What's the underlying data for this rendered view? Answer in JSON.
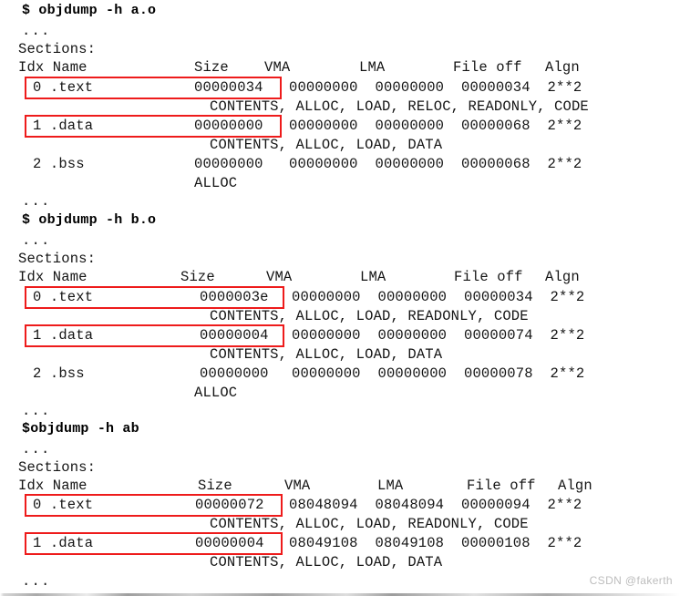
{
  "document": {
    "kind": "terminal-transcript",
    "watermark": "CSDN @fakerth",
    "colors": {
      "background": "#ffffff",
      "text": "#141414",
      "highlight": "#ee1b1b",
      "watermark": "#bdbdbd"
    }
  },
  "blocks": [
    {
      "id": "a-o",
      "command": "$ objdump -h a.o",
      "pre_ellipsis": "...",
      "sections_label": "Sections:",
      "header": "Idx Name          Size      VMA       LMA       File off  Algn",
      "header_cols": [
        "Idx",
        "Name",
        "Size",
        "VMA",
        "LMA",
        "File off",
        "Algn"
      ],
      "rows": [
        {
          "idx": "0",
          "name": ".text",
          "size": "00000034",
          "vma": "00000000",
          "lma": "00000000",
          "file_off": "00000034",
          "algn": "2**2",
          "flags": "CONTENTS, ALLOC, LOAD, RELOC, READONLY, CODE",
          "highlighted": true
        },
        {
          "idx": "1",
          "name": ".data",
          "size": "00000000",
          "vma": "00000000",
          "lma": "00000000",
          "file_off": "00000068",
          "algn": "2**2",
          "flags": "CONTENTS, ALLOC, LOAD, DATA",
          "highlighted": true
        },
        {
          "idx": "2",
          "name": ".bss",
          "size": "00000000",
          "vma": "00000000",
          "lma": "00000000",
          "file_off": "00000068",
          "algn": "2**2",
          "flags": "ALLOC",
          "highlighted": false
        }
      ],
      "post_ellipsis": "..."
    },
    {
      "id": "b-o",
      "command": "$ objdump -h b.o",
      "pre_ellipsis": "...",
      "sections_label": "Sections:",
      "header": "Idx Name          Size      VMA       LMA       File off  Algn",
      "header_cols": [
        "Idx",
        "Name",
        "Size",
        "VMA",
        "LMA",
        "File off",
        "Algn"
      ],
      "rows": [
        {
          "idx": "0",
          "name": ".text",
          "size": "0000003e",
          "vma": "00000000",
          "lma": "00000000",
          "file_off": "00000034",
          "algn": "2**2",
          "flags": "CONTENTS, ALLOC, LOAD, READONLY, CODE",
          "highlighted": true
        },
        {
          "idx": "1",
          "name": ".data",
          "size": "00000004",
          "vma": "00000000",
          "lma": "00000000",
          "file_off": "00000074",
          "algn": "2**2",
          "flags": "CONTENTS, ALLOC, LOAD, DATA",
          "highlighted": true
        },
        {
          "idx": "2",
          "name": ".bss",
          "size": "00000000",
          "vma": "00000000",
          "lma": "00000000",
          "file_off": "00000078",
          "algn": "2**2",
          "flags": "ALLOC",
          "highlighted": false
        }
      ],
      "post_ellipsis": "..."
    },
    {
      "id": "ab",
      "command": "$objdump -h ab",
      "pre_ellipsis": "...",
      "sections_label": "Sections:",
      "header": "Idx Name          Size      VMA       LMA       File off  Algn",
      "header_cols": [
        "Idx",
        "Name",
        "Size",
        "VMA",
        "LMA",
        "File off",
        "Algn"
      ],
      "rows": [
        {
          "idx": "0",
          "name": ".text",
          "size": "00000072",
          "vma": "08048094",
          "lma": "08048094",
          "file_off": "00000094",
          "algn": "2**2",
          "flags": "CONTENTS, ALLOC, LOAD, READONLY, CODE",
          "highlighted": true
        },
        {
          "idx": "1",
          "name": ".data",
          "size": "00000004",
          "vma": "08049108",
          "lma": "08049108",
          "file_off": "00000108",
          "algn": "2**2",
          "flags": "CONTENTS, ALLOC, LOAD, DATA",
          "highlighted": true
        }
      ],
      "post_ellipsis": "..."
    }
  ],
  "lines": {
    "b0_cmd": "$ objdump -h a.o",
    "b0_ell1": "...",
    "b0_sections": "Sections:",
    "b0_hdr_idxname": "Idx Name",
    "b0_hdr_size": "Size",
    "b0_hdr_vma": "VMA",
    "b0_hdr_lma": "LMA",
    "b0_hdr_fileoff": "File off",
    "b0_hdr_algn": "Algn",
    "b0_r0_idxname": "0 .text",
    "b0_r0_size": "00000034",
    "b0_r0_rest": "00000000  00000000  00000034  2**2",
    "b0_r0_flags": "CONTENTS, ALLOC, LOAD, RELOC, READONLY, CODE",
    "b0_r1_idxname": "1 .data",
    "b0_r1_size": "00000000",
    "b0_r1_rest": "00000000  00000000  00000068  2**2",
    "b0_r1_flags": "CONTENTS, ALLOC, LOAD, DATA",
    "b0_r2_idxname": "2 .bss",
    "b0_r2_size": "00000000",
    "b0_r2_rest": "00000000  00000000  00000068  2**2",
    "b0_r2_flags": "ALLOC",
    "b0_ell2": "...",
    "b1_cmd": "$ objdump -h b.o",
    "b1_ell1": "...",
    "b1_sections": "Sections:",
    "b1_hdr_idxname": "Idx Name",
    "b1_hdr_size": "Size",
    "b1_hdr_vma": "VMA",
    "b1_hdr_lma": "LMA",
    "b1_hdr_fileoff": "File off",
    "b1_hdr_algn": "Algn",
    "b1_r0_idxname": "0 .text",
    "b1_r0_size": "0000003e",
    "b1_r0_rest": "00000000  00000000  00000034  2**2",
    "b1_r0_flags": "CONTENTS, ALLOC, LOAD, READONLY, CODE",
    "b1_r1_idxname": "1 .data",
    "b1_r1_size": "00000004",
    "b1_r1_rest": "00000000  00000000  00000074  2**2",
    "b1_r1_flags": "CONTENTS, ALLOC, LOAD, DATA",
    "b1_r2_idxname": "2 .bss",
    "b1_r2_size": "00000000",
    "b1_r2_rest": "00000000  00000000  00000078  2**2",
    "b1_r2_flags": "ALLOC",
    "b1_ell2": "...",
    "b2_cmd": "$objdump -h ab",
    "b2_ell1": "...",
    "b2_sections": "Sections:",
    "b2_hdr_idxname": "Idx Name",
    "b2_hdr_size": "Size",
    "b2_hdr_vma": "VMA",
    "b2_hdr_lma": "LMA",
    "b2_hdr_fileoff": "File off",
    "b2_hdr_algn": "Algn",
    "b2_r0_idxname": "0 .text",
    "b2_r0_size": "00000072",
    "b2_r0_rest": "08048094  08048094  00000094  2**2",
    "b2_r0_flags": "CONTENTS, ALLOC, LOAD, READONLY, CODE",
    "b2_r1_idxname": "1 .data",
    "b2_r1_size": "00000004",
    "b2_r1_rest": "08049108  08049108  00000108  2**2",
    "b2_r1_flags": "CONTENTS, ALLOC, LOAD, DATA",
    "b2_ell2": "..."
  },
  "watermark": "CSDN @fakerth"
}
